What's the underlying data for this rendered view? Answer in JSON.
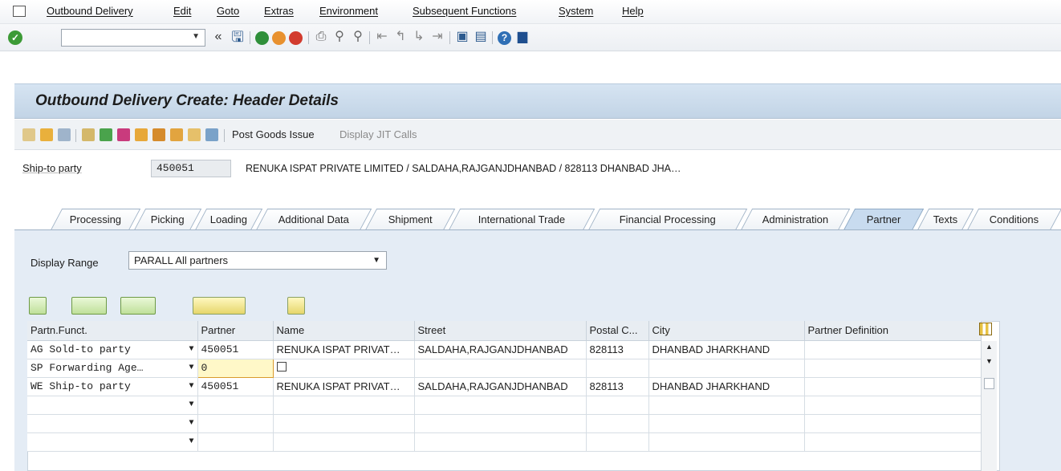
{
  "menu": {
    "items": [
      "Outbound Delivery",
      "Edit",
      "Goto",
      "Extras",
      "Environment",
      "Subsequent Functions",
      "System",
      "Help"
    ]
  },
  "toolbar": {
    "command_value": "",
    "icons": [
      "enter-check-icon",
      "command-dropdown-icon",
      "collapse-icon",
      "save-icon",
      "back-icon",
      "exit-icon",
      "cancel-icon",
      "print-icon",
      "find-icon",
      "find-next-icon",
      "first-page-icon",
      "previous-page-icon",
      "next-page-icon",
      "last-page-icon",
      "create-session-icon",
      "shortcut-icon",
      "help-icon",
      "layout-icon"
    ]
  },
  "title": "Outbound Delivery  Create: Header Details",
  "app_toolbar": {
    "post_goods_issue": "Post Goods Issue",
    "display_jit_calls": "Display JIT Calls"
  },
  "header": {
    "ship_to_label": "Ship-to party",
    "ship_to_value": "450051",
    "ship_to_description": "RENUKA ISPAT PRIVATE LIMITED / SALDAHA,RAJGANJDHANBAD / 828113 DHANBAD JHA…"
  },
  "tabs": [
    "Processing",
    "Picking",
    "Loading",
    "Additional Data",
    "Shipment",
    "International Trade",
    "Financial Processing",
    "Administration",
    "Partner",
    "Texts",
    "Conditions"
  ],
  "active_tab": "Partner",
  "display_range": {
    "label": "Display Range",
    "value": "PARALL All partners"
  },
  "grid": {
    "columns": [
      "Partn.Funct.",
      "Partner",
      "Name",
      "Street",
      "Postal C...",
      "City",
      "Partner Definition"
    ],
    "rows": [
      {
        "funct": "AG Sold-to party",
        "partner": "450051",
        "name": "RENUKA ISPAT PRIVAT…",
        "street": "SALDAHA,RAJGANJDHANBAD",
        "postal": "828113",
        "city": "DHANBAD JHARKHAND",
        "def": ""
      },
      {
        "funct": "SP Forwarding Age…",
        "partner": "0",
        "name": "",
        "street": "",
        "postal": "",
        "city": "",
        "def": ""
      },
      {
        "funct": "WE Ship-to party",
        "partner": "450051",
        "name": "RENUKA ISPAT PRIVAT…",
        "street": "SALDAHA,RAJGANJDHANBAD",
        "postal": "828113",
        "city": "DHANBAD JHARKHAND",
        "def": ""
      },
      {
        "funct": "",
        "partner": "",
        "name": "",
        "street": "",
        "postal": "",
        "city": "",
        "def": ""
      },
      {
        "funct": "",
        "partner": "",
        "name": "",
        "street": "",
        "postal": "",
        "city": "",
        "def": ""
      },
      {
        "funct": "",
        "partner": "",
        "name": "",
        "street": "",
        "postal": "",
        "city": "",
        "def": ""
      }
    ]
  },
  "colors": {
    "title_bg": "#c9daeb",
    "panel_bg": "#e4ecf5",
    "active_tab": "#c8dbef",
    "edit_cell": "#fff8c8"
  }
}
